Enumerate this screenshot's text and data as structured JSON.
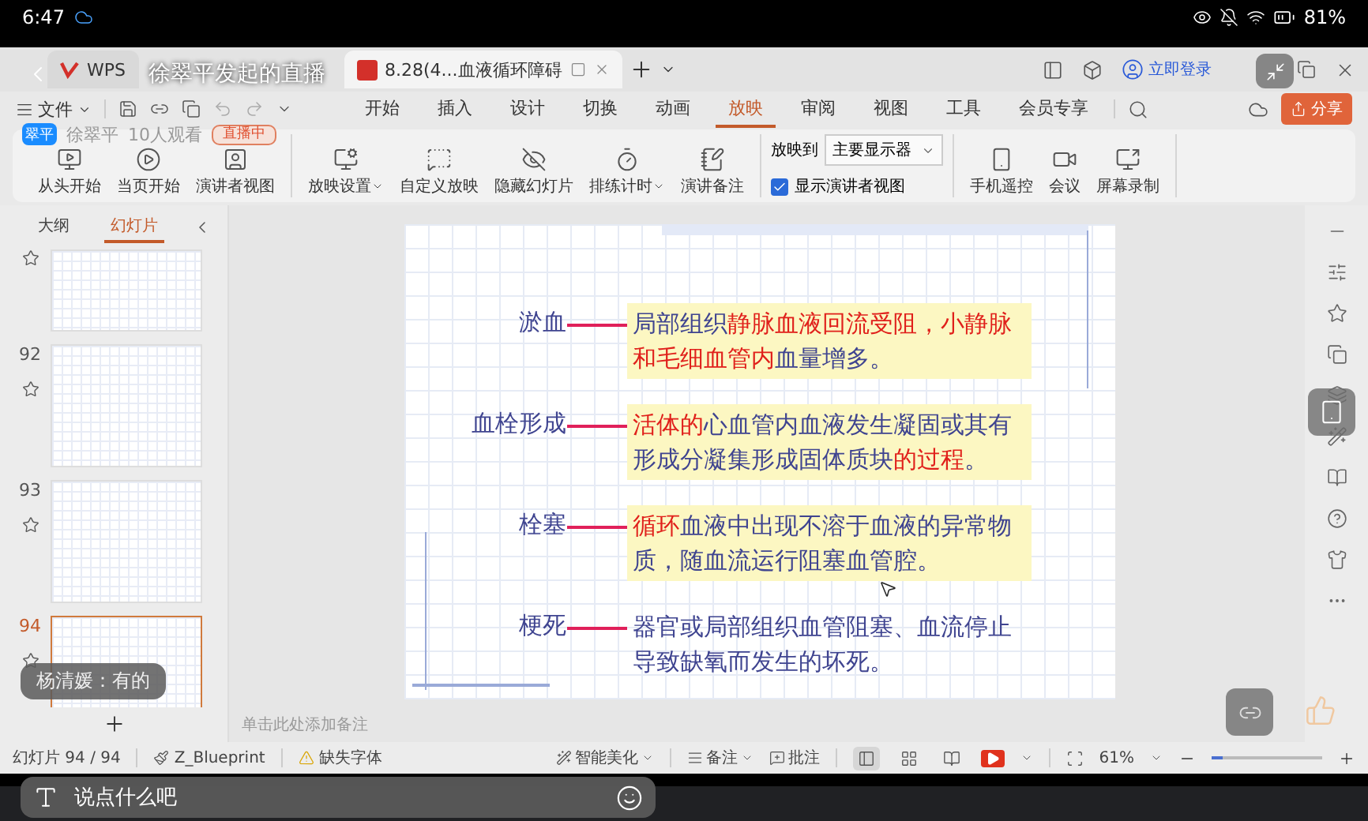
{
  "status_bar": {
    "time": "6:47",
    "battery": "81%"
  },
  "live": {
    "title": "徐翠平发起的直播",
    "avatar_text": "翠平",
    "host": "徐翠平",
    "viewers": "10人观看",
    "badge": "直播中"
  },
  "tabs": [
    {
      "label": "WPS",
      "kind": "home",
      "selected": false
    },
    {
      "label": "8.28(4...血液循环障碍",
      "kind": "doc",
      "selected": true
    }
  ],
  "login": "立即登录",
  "file_menu": "文件",
  "menu": [
    {
      "label": "开始",
      "selected": false
    },
    {
      "label": "插入",
      "selected": false
    },
    {
      "label": "设计",
      "selected": false
    },
    {
      "label": "切换",
      "selected": false
    },
    {
      "label": "动画",
      "selected": false
    },
    {
      "label": "放映",
      "selected": true
    },
    {
      "label": "审阅",
      "selected": false
    },
    {
      "label": "视图",
      "selected": false
    },
    {
      "label": "工具",
      "selected": false
    },
    {
      "label": "会员专享",
      "selected": false
    }
  ],
  "share": "分享",
  "ribbon": {
    "groups": [
      [
        {
          "label": "从头开始",
          "dropdown": false
        },
        {
          "label": "当页开始",
          "dropdown": false
        },
        {
          "label": "演讲者视图",
          "dropdown": false
        }
      ],
      [
        {
          "label": "放映设置",
          "dropdown": true
        },
        {
          "label": "自定义放映",
          "dropdown": false
        },
        {
          "label": "隐藏幻灯片",
          "dropdown": false
        },
        {
          "label": "排练计时",
          "dropdown": true
        },
        {
          "label": "演讲备注",
          "dropdown": false
        }
      ],
      [
        {
          "label": "手机遥控",
          "dropdown": false
        },
        {
          "label": "会议",
          "dropdown": false
        },
        {
          "label": "屏幕录制",
          "dropdown": false
        }
      ]
    ],
    "display_label": "放映到",
    "display_value": "主要显示器",
    "presenter_view": {
      "label": "显示演讲者视图",
      "checked": true
    }
  },
  "panel_tabs": [
    {
      "label": "大纲",
      "selected": false
    },
    {
      "label": "幻灯片",
      "selected": true
    }
  ],
  "slides": [
    {
      "selected": false
    },
    {
      "number": "92",
      "selected": false
    },
    {
      "number": "93",
      "selected": false
    },
    {
      "number": "94",
      "selected": true
    }
  ],
  "slide": {
    "rows": [
      {
        "term": "淤血",
        "boxed": true,
        "segments": [
          {
            "text": "局部组织",
            "emphasis": false
          },
          {
            "text": "静脉血液回流受阻，小静脉和毛细血管内",
            "emphasis": true
          },
          {
            "text": "血量增多。",
            "emphasis": false
          }
        ]
      },
      {
        "term": "血栓形成",
        "boxed": true,
        "segments": [
          {
            "text": "活体的",
            "emphasis": true
          },
          {
            "text": "心血管内血液发生凝固或其有形成分凝集形成固体质块",
            "emphasis": false
          },
          {
            "text": "的过程",
            "emphasis": true
          },
          {
            "text": "。",
            "emphasis": false
          }
        ]
      },
      {
        "term": "栓塞",
        "boxed": true,
        "segments": [
          {
            "text": "循环",
            "emphasis": true
          },
          {
            "text": "血液中出现不溶于血液的异常物质，随血流运行阻塞血管腔。",
            "emphasis": false
          }
        ]
      },
      {
        "term": "梗死",
        "boxed": false,
        "segments": [
          {
            "text": "器官或局部组织血管阻塞、血流停止导致缺氧而发生的坏死。",
            "emphasis": false
          }
        ]
      }
    ]
  },
  "notes_placeholder": "单击此处添加备注",
  "bottom_bar": {
    "slide_count": "幻灯片 94 / 94",
    "theme": "Z_Blueprint",
    "missing_font": "缺失字体",
    "beautify": "智能美化",
    "notes": "备注",
    "comments": "批注",
    "views": [
      {
        "selected": true
      },
      {
        "selected": false
      },
      {
        "selected": false
      }
    ],
    "zoom": "61%",
    "level": 0.1
  },
  "chat": {
    "user": "杨清媛：",
    "message": "有的",
    "input_placeholder": "说点什么吧"
  }
}
